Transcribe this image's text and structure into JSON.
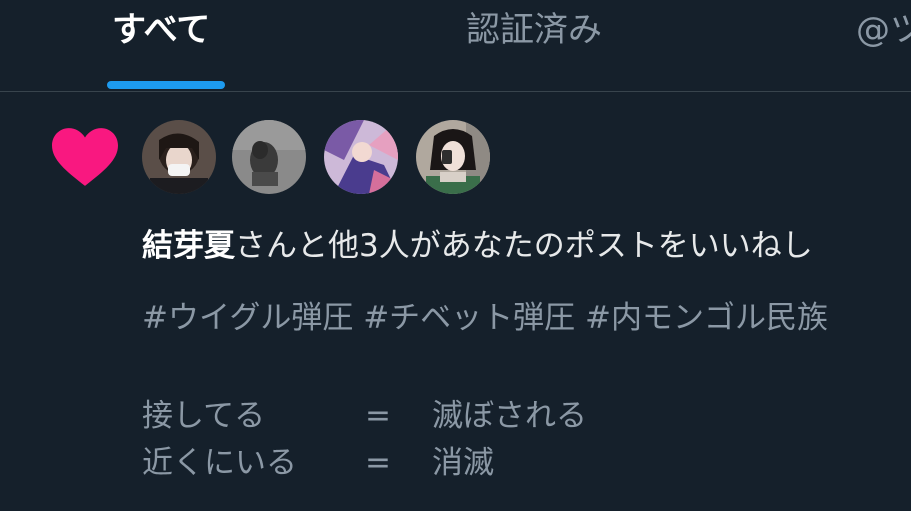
{
  "tabs": [
    {
      "label": "すべて"
    },
    {
      "label": "認証済み"
    },
    {
      "label": "@ツ"
    }
  ],
  "notification": {
    "icon": "heart-icon",
    "heart_color": "#f91880",
    "user_name": "結芽夏",
    "summary_rest": "さんと他3人があなたのポストをいいねし",
    "hashtags": "#ウイグル弾圧 #チベット弾圧 #内モンゴル民族",
    "lines": [
      {
        "left": "接してる",
        "eq": "=",
        "right": "滅ぼされる"
      },
      {
        "left": "近くにいる",
        "eq": "=",
        "right": "消滅"
      }
    ]
  },
  "colors": {
    "background": "#15202b",
    "accent": "#1d9bf0",
    "text_primary": "#e7e9ea",
    "text_secondary": "#8b98a5",
    "divider": "#38444d"
  }
}
